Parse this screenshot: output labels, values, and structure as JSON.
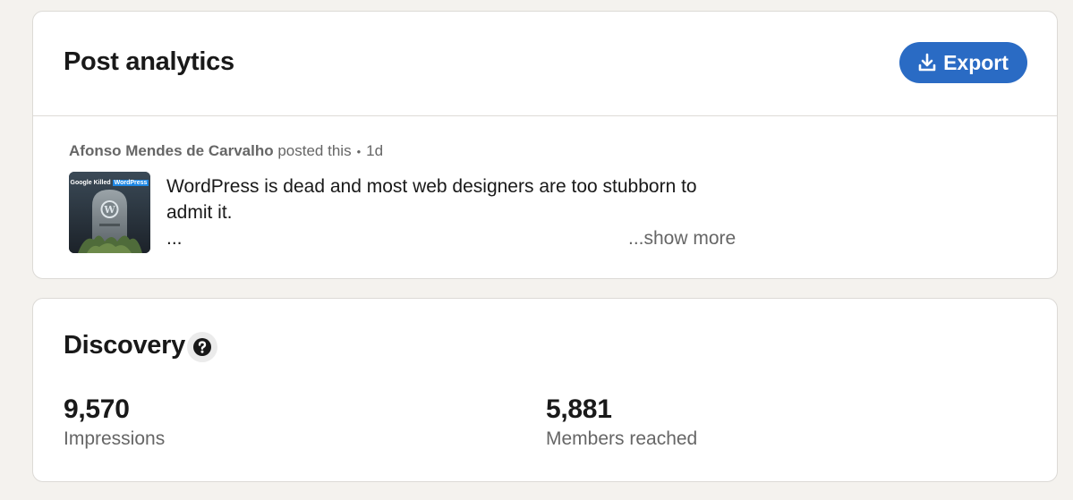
{
  "header": {
    "title": "Post analytics",
    "export_label": "Export"
  },
  "post": {
    "author": "Afonso Mendes de Carvalho",
    "action": "posted this",
    "separator": "•",
    "age": "1d",
    "thumbnail": {
      "caption_plain": "Google Killed",
      "caption_highlight": "WordPress",
      "icon": "tombstone-wordpress-image"
    },
    "text": "WordPress is dead and most web designers are too stubborn to admit it.",
    "ellipsis": "...",
    "show_more_label": "...show more"
  },
  "discovery": {
    "title": "Discovery",
    "help_icon": "question-circle-icon",
    "metrics": [
      {
        "value": "9,570",
        "label": "Impressions"
      },
      {
        "value": "5,881",
        "label": "Members reached"
      }
    ]
  },
  "colors": {
    "accent": "#0a66c2",
    "page_background": "#f4f2ee",
    "card_background": "#ffffff",
    "muted_text": "#666666"
  }
}
